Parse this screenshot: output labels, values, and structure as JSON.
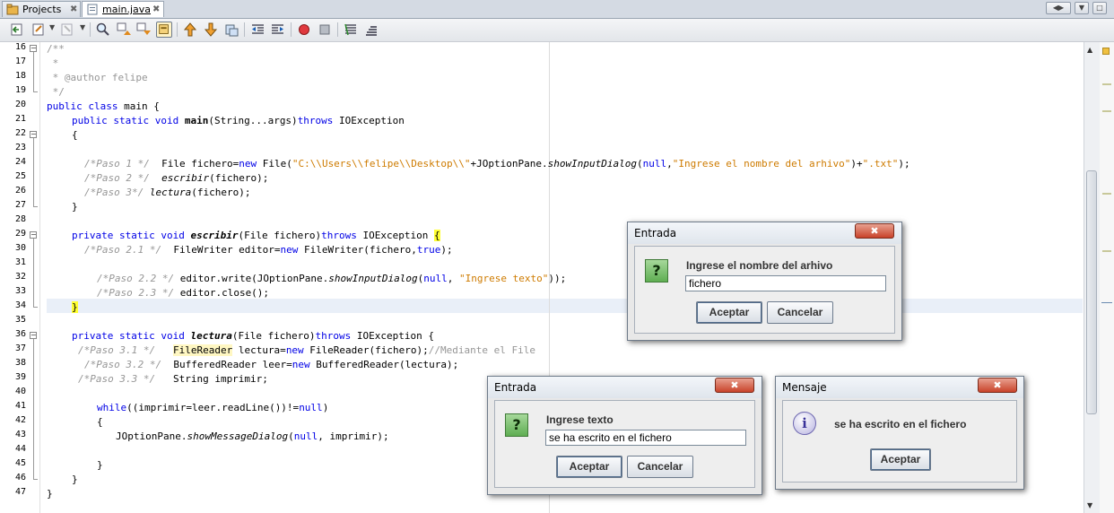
{
  "tabs": [
    {
      "label": "Projects",
      "close": "✖"
    },
    {
      "label": "main.java",
      "close": "✖"
    }
  ],
  "nav_buttons": [
    "◀▶",
    "▼",
    "□"
  ],
  "toolbar_icons": [
    "last-edit-icon",
    "back-icon",
    "forward-icon",
    "find-icon",
    "find-previous-icon",
    "find-next-icon",
    "toggle-highlight-icon",
    "previous-bookmark-icon",
    "next-bookmark-icon",
    "toggle-bookmark-icon",
    "shift-left-icon",
    "shift-right-icon",
    "record-macro-icon",
    "stop-macro-icon",
    "comment-icon",
    "uncomment-icon"
  ],
  "line_numbers": [
    "16",
    "17",
    "18",
    "19",
    "20",
    "21",
    "22",
    "23",
    "24",
    "25",
    "26",
    "27",
    "28",
    "29",
    "30",
    "31",
    "32",
    "33",
    "34",
    "35",
    "36",
    "37",
    "38",
    "39",
    "40",
    "41",
    "42",
    "43",
    "44",
    "45",
    "46",
    "47"
  ],
  "code": {
    "l16": "/**",
    "l17": " *",
    "l18": " * @author felipe",
    "l19": " */",
    "l20_kw": "public class",
    "l20_rest": " main {",
    "l21_kw1": "public static void",
    "l21_name": "main",
    "l21_mid": "(String...args)",
    "l21_kw2": "throws",
    "l21_end": " IOException",
    "l22": "{",
    "l24_cm": "/*Paso 1 */",
    "l24_a": "  File fichero=",
    "l24_new": "new",
    "l24_b": " File(",
    "l24_str1": "\"C:\\\\Users\\\\felipe\\\\Desktop\\\\\"",
    "l24_c": "+JOptionPane.",
    "l24_m": "showInputDialog",
    "l24_d": "(",
    "l24_null": "null",
    "l24_e": ",",
    "l24_str2": "\"Ingrese el nombre del arhivo\"",
    "l24_f": ")+",
    "l24_str3": "\".txt\"",
    "l24_g": ");",
    "l25_cm": "/*Paso 2 */",
    "l25_m": "escribir",
    "l25_rest": "(fichero);",
    "l26_cm": "/*Paso 3*/",
    "l26_m": "lectura",
    "l26_rest": "(fichero);",
    "l27": "}",
    "l29_kw": "private static void",
    "l29_m": "escribir",
    "l29_mid": "(File fichero)",
    "l29_kw2": "throws",
    "l29_end": " IOException ",
    "l29_brace": "{",
    "l30_cm": "/*Paso 2.1 */",
    "l30_a": "  FileWriter editor=",
    "l30_new": "new",
    "l30_b": " FileWriter(fichero,",
    "l30_true": "true",
    "l30_c": ");",
    "l32_cm": "/*Paso 2.2 */",
    "l32_a": " editor.write(JOptionPane.",
    "l32_m": "showInputDialog",
    "l32_b": "(",
    "l32_null": "null",
    "l32_c": ", ",
    "l32_str": "\"Ingrese texto\"",
    "l32_d": "));",
    "l33_cm": "/*Paso 2.3 */",
    "l33_a": " editor.close();",
    "l34": "}",
    "l36_kw": "private static void",
    "l36_m": "lectura",
    "l36_mid": "(File fichero)",
    "l36_kw2": "throws",
    "l36_end": " IOException {",
    "l37_cm": "/*Paso 3.1 */",
    "l37_cls": "FileReader",
    "l37_a": " lectura=",
    "l37_new": "new",
    "l37_b": " FileReader(fichero);",
    "l37_cm2": "//Mediante el File",
    "l38_cm": "/*Paso 3.2 */",
    "l38_a": "  BufferedReader leer=",
    "l38_new": "new",
    "l38_b": " BufferedReader(lectura);",
    "l39_cm": "/*Paso 3.3 */",
    "l39_a": "   String imprimir;",
    "l41_kw": "while",
    "l41_a": "((imprimir=leer.readLine())!=",
    "l41_null": "null",
    "l41_b": ")",
    "l42": "{",
    "l43_a": "JOptionPane.",
    "l43_m": "showMessageDialog",
    "l43_b": "(",
    "l43_null": "null",
    "l43_c": ", imprimir);",
    "l45": "}",
    "l46": "}",
    "l47": "}"
  },
  "dialog_file": {
    "title": "Entrada",
    "close": "✖",
    "icon_glyph": "?",
    "message": "Ingrese el nombre del arhivo",
    "input_value": "fichero",
    "ok_label": "Aceptar",
    "cancel_label": "Cancelar"
  },
  "dialog_text": {
    "title": "Entrada",
    "close": "✖",
    "icon_glyph": "?",
    "message": "Ingrese texto",
    "input_value": "se ha escrito en el fichero",
    "ok_label": "Aceptar",
    "cancel_label": "Cancelar"
  },
  "dialog_message": {
    "title": "Mensaje",
    "close": "✖",
    "icon_glyph": "i",
    "message": "se ha escrito en el fichero",
    "ok_label": "Aceptar"
  }
}
